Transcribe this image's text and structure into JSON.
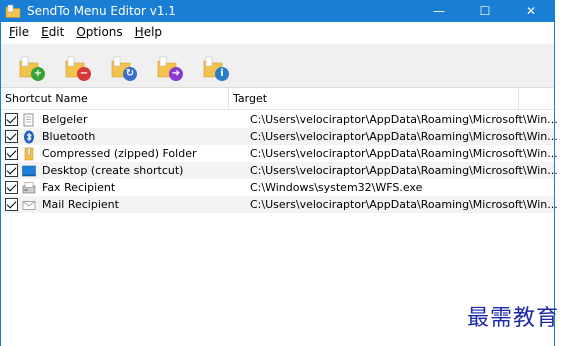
{
  "window": {
    "title": "SendTo Menu Editor v1.1",
    "controls": {
      "minimize": "—",
      "maximize": "☐",
      "close": "✕"
    }
  },
  "menubar": {
    "items": [
      {
        "label": "File",
        "mnemonic": "F"
      },
      {
        "label": "Edit",
        "mnemonic": "E"
      },
      {
        "label": "Options",
        "mnemonic": "O"
      },
      {
        "label": "Help",
        "mnemonic": "H"
      }
    ]
  },
  "toolbar": {
    "buttons": [
      {
        "icon": "folder-add-icon",
        "badge": "+",
        "color": "#3aa03a"
      },
      {
        "icon": "folder-remove-icon",
        "badge": "−",
        "color": "#d43a3a"
      },
      {
        "icon": "folder-refresh-icon",
        "badge": "↻",
        "color": "#3a6fd0"
      },
      {
        "icon": "folder-move-icon",
        "badge": "➜",
        "color": "#8a3ad0"
      },
      {
        "icon": "folder-info-icon",
        "badge": "i",
        "color": "#2a7fc8"
      }
    ]
  },
  "list": {
    "columns": {
      "name": "Shortcut Name",
      "target": "Target"
    },
    "rows": [
      {
        "checked": true,
        "icon": "document-icon",
        "name": "Belgeler",
        "target": "C:\\Users\\velociraptor\\AppData\\Roaming\\Microsoft\\Win..."
      },
      {
        "checked": true,
        "icon": "bluetooth-icon",
        "name": "Bluetooth",
        "target": "C:\\Users\\velociraptor\\AppData\\Roaming\\Microsoft\\Win..."
      },
      {
        "checked": true,
        "icon": "zip-folder-icon",
        "name": "Compressed (zipped) Folder",
        "target": "C:\\Users\\velociraptor\\AppData\\Roaming\\Microsoft\\Win..."
      },
      {
        "checked": true,
        "icon": "desktop-icon",
        "name": "Desktop (create shortcut)",
        "target": "C:\\Users\\velociraptor\\AppData\\Roaming\\Microsoft\\Win..."
      },
      {
        "checked": true,
        "icon": "fax-icon",
        "name": "Fax Recipient",
        "target": "C:\\Windows\\system32\\WFS.exe"
      },
      {
        "checked": true,
        "icon": "mail-icon",
        "name": "Mail Recipient",
        "target": "C:\\Users\\velociraptor\\AppData\\Roaming\\Microsoft\\Win..."
      }
    ]
  },
  "watermark": "最需教育",
  "colors": {
    "titlebar": "#1a7fd4",
    "folder": "#f2c24d",
    "alt_row": "#f3f3f3"
  }
}
